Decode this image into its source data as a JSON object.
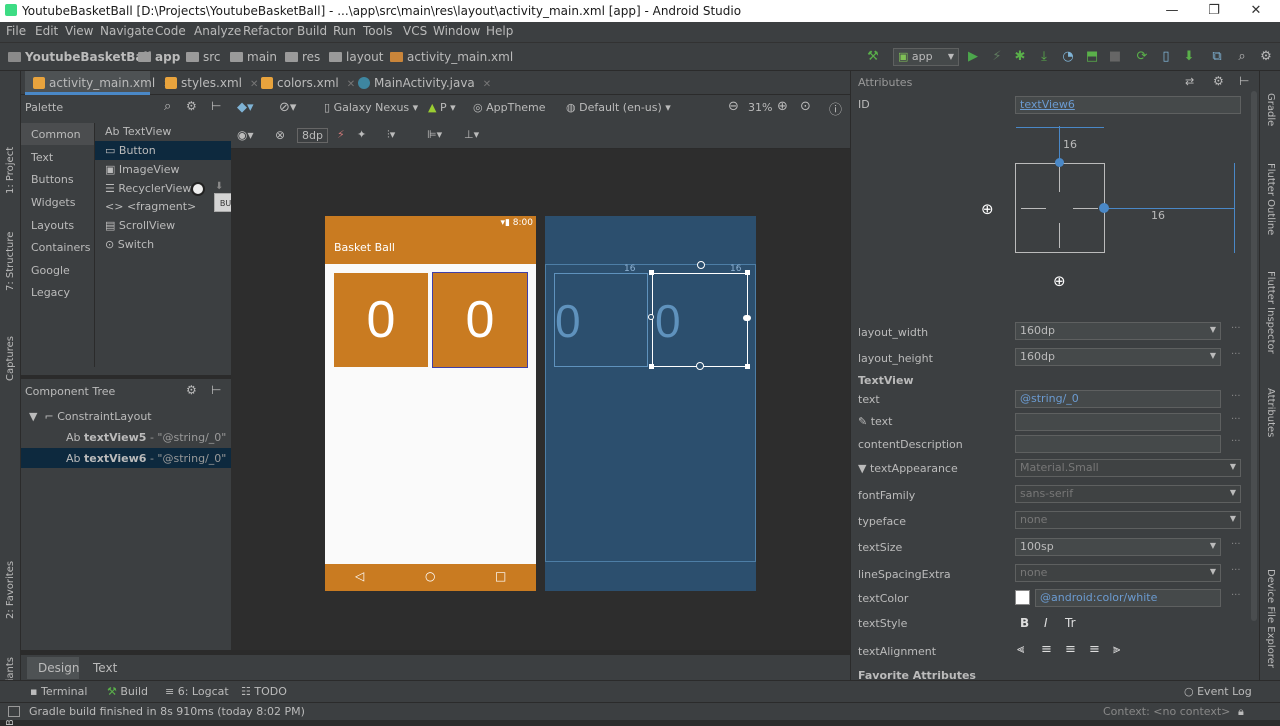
{
  "window": {
    "title": "YoutubeBasketBall [D:\\Projects\\YoutubeBasketBall] - ...\\app\\src\\main\\res\\layout\\activity_main.xml [app] - Android Studio",
    "minimize": "—",
    "maximize": "❐",
    "close": "✕"
  },
  "menu": [
    "File",
    "Edit",
    "View",
    "Navigate",
    "Code",
    "Analyze",
    "Refactor",
    "Build",
    "Run",
    "Tools",
    "VCS",
    "Window",
    "Help"
  ],
  "breadcrumb": [
    "YoutubeBasketBall",
    "app",
    "src",
    "main",
    "res",
    "layout",
    "activity_main.xml"
  ],
  "run_config": "app",
  "tabs": [
    {
      "label": "activity_main.xml",
      "color": "#e8a33d"
    },
    {
      "label": "styles.xml",
      "color": "#e8a33d"
    },
    {
      "label": "colors.xml",
      "color": "#e8a33d"
    },
    {
      "label": "MainActivity.java",
      "color": "#3e86a0"
    }
  ],
  "left_strip": [
    "1: Project",
    "7: Structure",
    "Captures",
    "2: Favorites",
    "Build Variants"
  ],
  "right_strip": [
    "Gradle",
    "Flutter Outline",
    "Flutter Inspector",
    "Attributes",
    "Device File Explorer"
  ],
  "palette": {
    "title": "Palette",
    "categories": [
      "Common",
      "Text",
      "Buttons",
      "Widgets",
      "Layouts",
      "Containers",
      "Google",
      "Legacy"
    ],
    "items": [
      {
        "prefix": "Ab",
        "label": "TextView"
      },
      {
        "prefix": "▭",
        "label": "Button"
      },
      {
        "prefix": "▣",
        "label": "ImageView"
      },
      {
        "prefix": "☰",
        "label": "RecyclerView"
      },
      {
        "prefix": "<>",
        "label": "<fragment>"
      },
      {
        "prefix": "▤",
        "label": "ScrollView"
      },
      {
        "prefix": "⊙",
        "label": "Switch"
      }
    ],
    "tooltip": "BUTTON"
  },
  "component_tree": {
    "title": "Component Tree",
    "root": "ConstraintLayout",
    "children": [
      {
        "prefix": "Ab",
        "id": "textView5",
        "value": " - \"@string/_0\""
      },
      {
        "prefix": "Ab",
        "id": "textView6",
        "value": " - \"@string/_0\""
      }
    ]
  },
  "design_toolbar": {
    "device": "Galaxy Nexus",
    "api": "P",
    "theme": "AppTheme",
    "locale": "Default (en-us)",
    "zoom": "31%",
    "margin": "8dp"
  },
  "phone": {
    "time": "8:00",
    "app_title": "Basket Ball",
    "score_left": "0",
    "score_right": "0"
  },
  "blueprint": {
    "score_left": "0",
    "score_right": "0",
    "margin_top": "16",
    "margin_side": "16"
  },
  "bottom_tabs": [
    "Design",
    "Text"
  ],
  "tool_windows": [
    "Terminal",
    "Build",
    "6: Logcat",
    "TODO"
  ],
  "event_log": "Event Log",
  "status": {
    "message": "Gradle build finished in 8s 910ms (today 8:02 PM)",
    "context": "Context: <no context>"
  },
  "attributes": {
    "title": "Attributes",
    "id_label": "ID",
    "id_value": "textView6",
    "constraint_top": "16",
    "constraint_right": "16",
    "layout_width_label": "layout_width",
    "layout_width": "160dp",
    "layout_height_label": "layout_height",
    "layout_height": "160dp",
    "section": "TextView",
    "text_label": "text",
    "text_value": "@string/_0",
    "tools_text_label": "text",
    "content_desc_label": "contentDescription",
    "text_appearance_label": "textAppearance",
    "text_appearance": "Material.Small",
    "font_family_label": "fontFamily",
    "font_family": "sans-serif",
    "typeface_label": "typeface",
    "typeface": "none",
    "text_size_label": "textSize",
    "text_size": "100sp",
    "line_spacing_label": "lineSpacingExtra",
    "line_spacing": "none",
    "text_color_label": "textColor",
    "text_color": "@android:color/white",
    "text_style_label": "textStyle",
    "text_alignment_label": "textAlignment",
    "favorite_label": "Favorite Attributes"
  },
  "colors": {
    "accent_orange": "#c97b21",
    "blueprint": "#2c4f6e",
    "selection_blue": "#0d293e"
  }
}
